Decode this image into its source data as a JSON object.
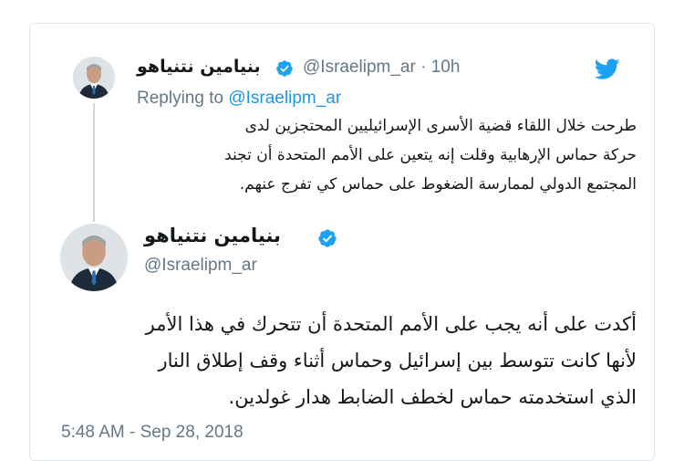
{
  "reply_tweet": {
    "display_name": "بنيامين نتنياهو",
    "handle_time": "@Israelipm_ar · 10h",
    "replying_prefix": "Replying to ",
    "replying_handle": "@Israelipm_ar",
    "text_lines": [
      "طرحت خلال اللقاء قضية الأسرى الإسرائيليين المحتجزين لدى",
      "حركة حماس الإرهابية وقلت إنه يتعين على الأمم المتحدة أن تجند",
      "المجتمع الدولي لممارسة الضغوط على حماس كي تفرج عنهم."
    ]
  },
  "main_tweet": {
    "display_name": "بنيامين نتنياهو",
    "handle": "@Israelipm_ar",
    "text_lines": [
      "أكدت على أنه يجب على الأمم المتحدة أن تتحرك في هذا الأمر",
      "لأنها كانت تتوسط بين إسرائيل وحماس أثناء وقف إطلاق النار",
      "الذي استخدمته حماس لخطف الضابط هدار غولدين."
    ],
    "timestamp": "5:48 AM - Sep 28, 2018"
  },
  "colors": {
    "accent": "#1da1f2",
    "verified": "#1da1f2",
    "text": "#14171a",
    "secondary": "#657786",
    "link": "#1b95e0"
  },
  "icons": {
    "brand": "twitter-bird-icon",
    "verified": "verified-badge-icon"
  }
}
